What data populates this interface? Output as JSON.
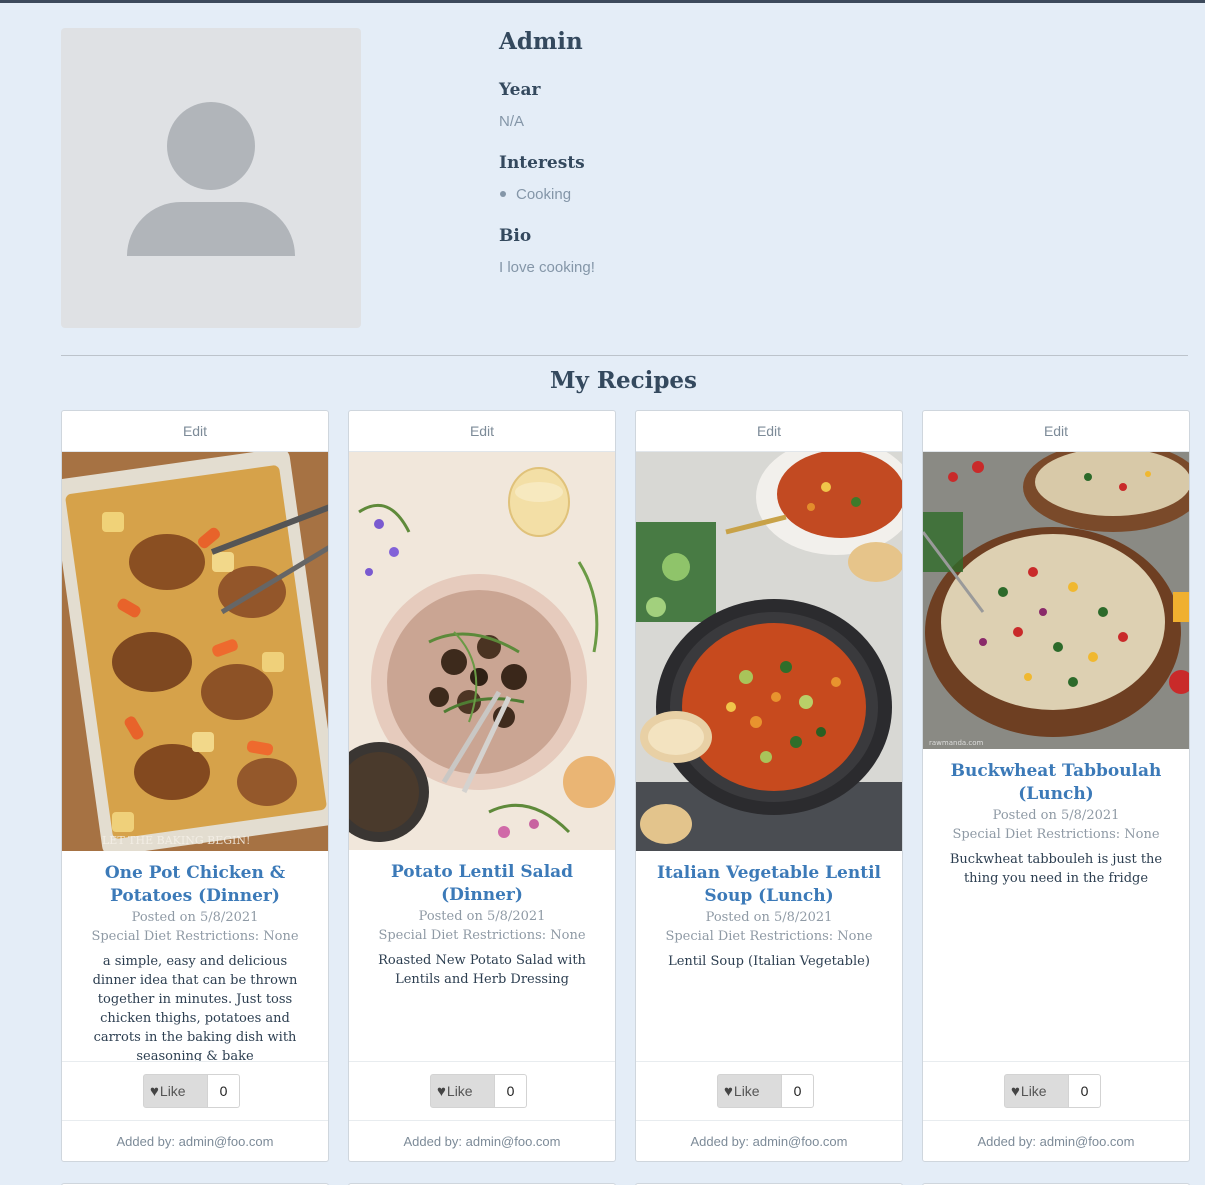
{
  "profile": {
    "name": "Admin",
    "year_label": "Year",
    "year_value": "N/A",
    "interests_label": "Interests",
    "interests": [
      "Cooking"
    ],
    "bio_label": "Bio",
    "bio_value": "I love cooking!"
  },
  "section_title": "My Recipes",
  "recipes": [
    {
      "edit_label": "Edit",
      "title": "One Pot Chicken & Potatoes (Dinner)",
      "posted": "Posted on 5/8/2021",
      "diet": "Special Diet Restrictions: None",
      "description": "a simple, easy and delicious dinner idea that can be thrown together in minutes. Just toss chicken thighs, potatoes and carrots in the baking dish with seasoning & bake",
      "like_label": "Like",
      "like_count": "0",
      "added_by": "Added by: admin@foo.com"
    },
    {
      "edit_label": "Edit",
      "title": "Potato Lentil Salad (Dinner)",
      "posted": "Posted on 5/8/2021",
      "diet": "Special Diet Restrictions: None",
      "description": "Roasted New Potato Salad with Lentils and Herb Dressing",
      "like_label": "Like",
      "like_count": "0",
      "added_by": "Added by: admin@foo.com"
    },
    {
      "edit_label": "Edit",
      "title": "Italian Vegetable Lentil Soup (Lunch)",
      "posted": "Posted on 5/8/2021",
      "diet": "Special Diet Restrictions: None",
      "description": "Lentil Soup (Italian Vegetable)",
      "like_label": "Like",
      "like_count": "0",
      "added_by": "Added by: admin@foo.com"
    },
    {
      "edit_label": "Edit",
      "title": "Buckwheat Tabboulah (Lunch)",
      "posted": "Posted on 5/8/2021",
      "diet": "Special Diet Restrictions: None",
      "description": "Buckwheat tabbouleh is just the thing you need in the fridge",
      "like_label": "Like",
      "like_count": "0",
      "added_by": "Added by: admin@foo.com"
    }
  ],
  "image_watermarks": [
    "LET THE BAKING BEGIN!",
    "rawmanda.com"
  ]
}
